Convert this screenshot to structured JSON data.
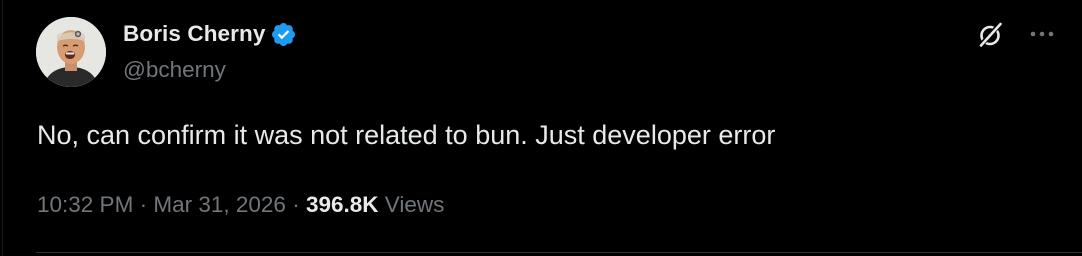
{
  "author": {
    "display_name": "Boris Cherny",
    "handle": "@bcherny",
    "verified": true,
    "avatar_icon": "avatar-photo"
  },
  "tweet": {
    "text": "No, can confirm it was not related to bun. Just developer error"
  },
  "meta": {
    "time": "10:32 PM",
    "separator": "·",
    "date": "Mar 31, 2026",
    "views_count": "396.8K",
    "views_label": "Views"
  },
  "actions": {
    "grok_icon": "grok-icon",
    "more_icon": "more-icon"
  },
  "colors": {
    "background": "#000000",
    "text_primary": "#e7e9ea",
    "text_secondary": "#71767b",
    "verified_blue": "#1d9bf0"
  }
}
